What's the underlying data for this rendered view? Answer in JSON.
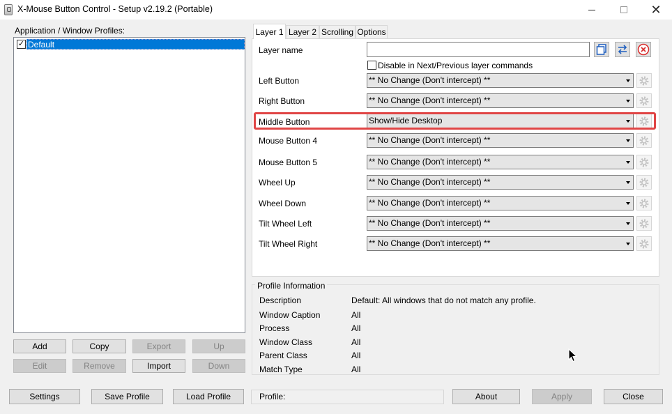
{
  "window": {
    "title": "X-Mouse Button Control - Setup v2.19.2 (Portable)",
    "close_glyph": "✕"
  },
  "profiles": {
    "label": "Application / Window Profiles:",
    "items": [
      {
        "name": "Default",
        "checked": true,
        "selected": true
      }
    ],
    "buttons": {
      "add": "Add",
      "copy": "Copy",
      "export": "Export",
      "up": "Up",
      "edit": "Edit",
      "remove": "Remove",
      "import": "Import",
      "down": "Down"
    }
  },
  "tabs": [
    "Layer 1",
    "Layer 2",
    "Scrolling",
    "Options"
  ],
  "layer": {
    "name_label": "Layer name",
    "name_value": "",
    "disable_label": "Disable in Next/Previous layer commands",
    "disable_checked": false
  },
  "mappings": [
    {
      "label": "Left Button",
      "value": "** No Change (Don't intercept) **"
    },
    {
      "label": "Right Button",
      "value": "** No Change (Don't intercept) **"
    },
    {
      "label": "Middle Button",
      "value": "Show/Hide Desktop",
      "highlighted": true
    },
    {
      "label": "Mouse Button 4",
      "value": "** No Change (Don't intercept) **"
    },
    {
      "label": "Mouse Button 5",
      "value": "** No Change (Don't intercept) **"
    },
    {
      "label": "Wheel Up",
      "value": "** No Change (Don't intercept) **"
    },
    {
      "label": "Wheel Down",
      "value": "** No Change (Don't intercept) **"
    },
    {
      "label": "Tilt Wheel Left",
      "value": "** No Change (Don't intercept) **"
    },
    {
      "label": "Tilt Wheel Right",
      "value": "** No Change (Don't intercept) **"
    }
  ],
  "profile_info": {
    "title": "Profile Information",
    "rows": [
      {
        "label": "Description",
        "value": "Default: All windows that do not match any profile."
      },
      {
        "label": "Window Caption",
        "value": "All"
      },
      {
        "label": "Process",
        "value": "All"
      },
      {
        "label": "Window Class",
        "value": "All"
      },
      {
        "label": "Parent Class",
        "value": "All"
      },
      {
        "label": "Match Type",
        "value": "All"
      }
    ]
  },
  "bottom": {
    "settings": "Settings",
    "save_profile": "Save Profile",
    "load_profile": "Load Profile",
    "status_profile": "Profile:",
    "about": "About",
    "apply": "Apply",
    "close": "Close"
  },
  "colors": {
    "selection": "#0078d7",
    "highlight_border": "#e04545",
    "icon_blue": "#1f5fbf",
    "icon_red": "#d92c2c"
  }
}
